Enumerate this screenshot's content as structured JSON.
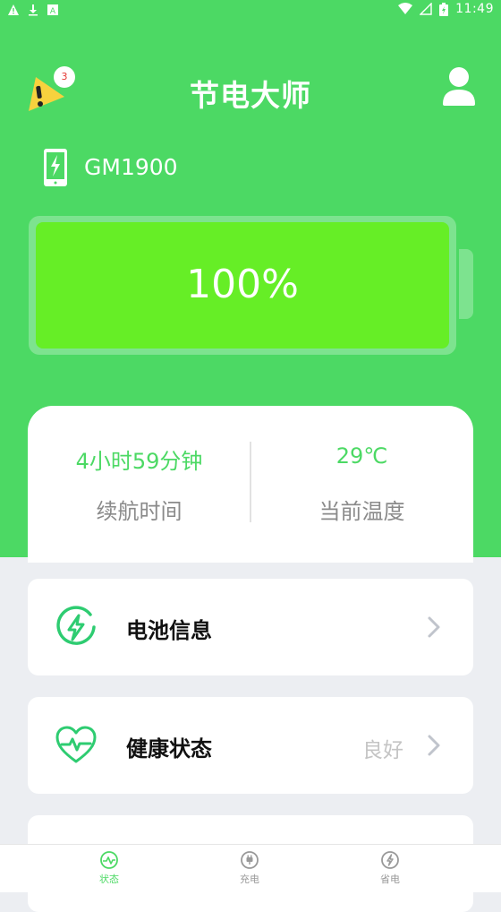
{
  "status_bar": {
    "time": "11:49",
    "left_icons": [
      "warning-icon",
      "download-icon",
      "notification-icon"
    ],
    "right_icons": [
      "wifi-icon",
      "signal-icon",
      "battery-icon"
    ]
  },
  "header": {
    "title": "节电大师",
    "alert_badge": "3"
  },
  "device": {
    "name": "GM1900"
  },
  "battery": {
    "level_text": "100%",
    "level": 1.0
  },
  "stats": {
    "endurance": {
      "value": "4小时59分钟",
      "label": "续航时间"
    },
    "temperature": {
      "value": "29℃",
      "label": "当前温度"
    }
  },
  "menu": {
    "battery_info": {
      "label": "电池信息"
    },
    "health": {
      "label": "健康状态",
      "value": "良好"
    }
  },
  "bottom_nav": {
    "status": "状态",
    "charge": "充电",
    "save": "省电"
  },
  "colors": {
    "primary": "#4cd964",
    "battery_fill": "#66ee26",
    "inactive": "#999999"
  }
}
